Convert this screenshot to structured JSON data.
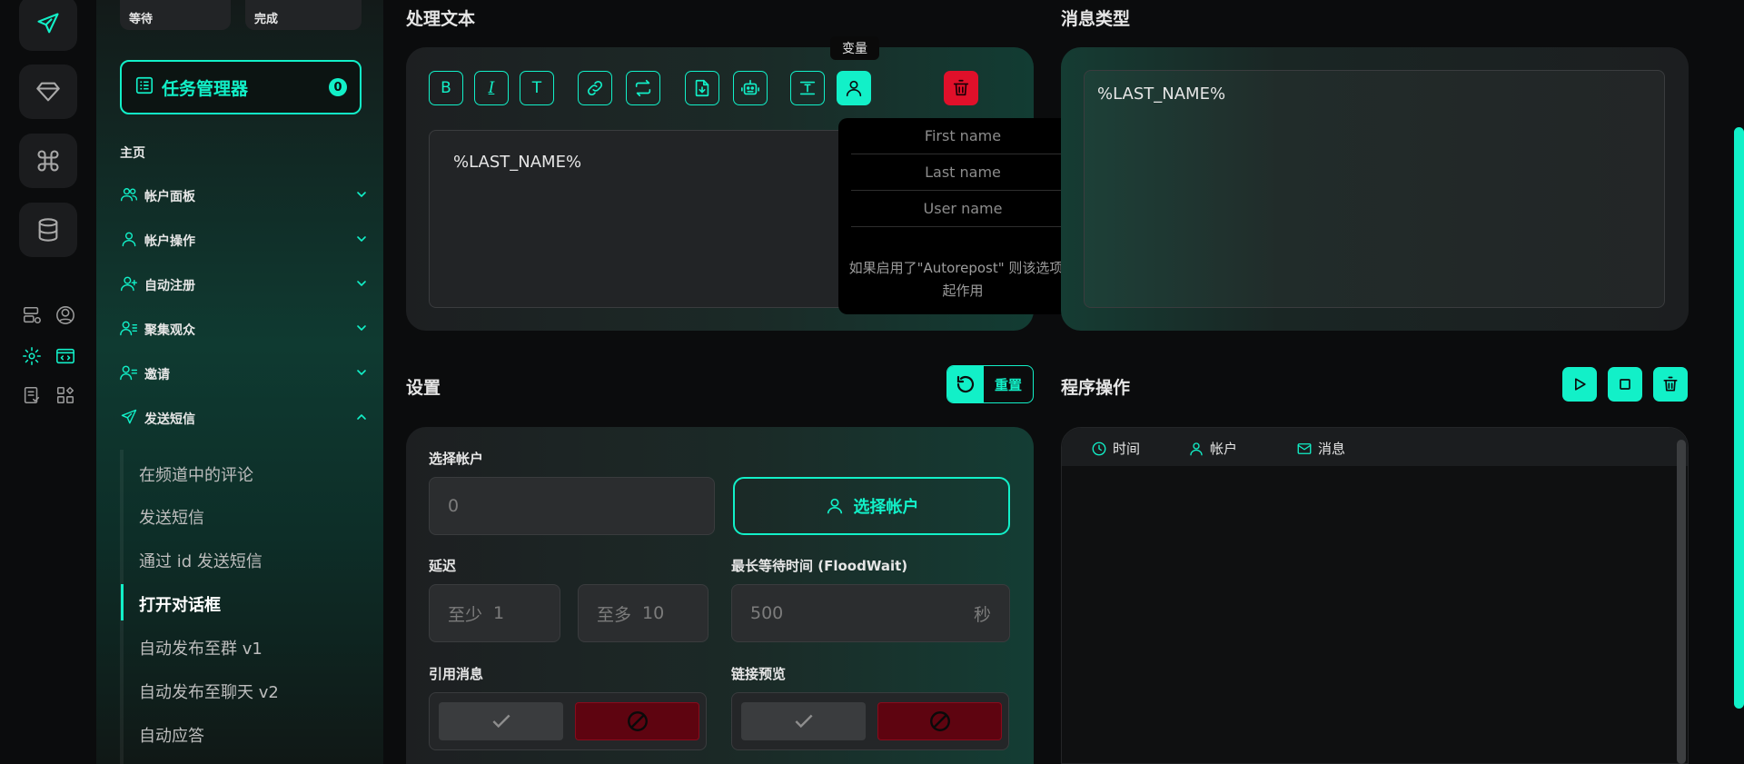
{
  "sidebar": {
    "status_waiting": "等待",
    "status_done": "完成",
    "task_manager": {
      "label": "任务管理器",
      "count": "0"
    },
    "home": "主页",
    "nav": [
      {
        "label": "帐户面板",
        "icon": "users-icon"
      },
      {
        "label": "帐户操作",
        "icon": "user-icon"
      },
      {
        "label": "自动注册",
        "icon": "user-plus-icon"
      },
      {
        "label": "聚集观众",
        "icon": "users-list-icon"
      },
      {
        "label": "邀请",
        "icon": "user-list-icon"
      },
      {
        "label": "发送短信",
        "icon": "send-icon"
      }
    ],
    "sub_items": [
      "在频道中的评论",
      "发送短信",
      "通过 id 发送短信",
      "打开对话框",
      "自动发布至群 v1",
      "自动发布至聊天 v2",
      "自动应答"
    ],
    "active_sub": "打开对话框"
  },
  "editor": {
    "title": "处理文本",
    "tooltip": "变量",
    "text": "%LAST_NAME%",
    "toolbar": {
      "bold": "B",
      "italic": "I",
      "text": "T"
    },
    "variables": [
      "First name",
      "Last name",
      "User name"
    ],
    "variables_note": "如果启用了\"Autorepost\" 则该选项不起作用"
  },
  "message_type": {
    "title": "消息类型",
    "text": "%LAST_NAME%"
  },
  "settings": {
    "title": "设置",
    "reset": "重置",
    "select_account_label": "选择帐户",
    "account_count": "0",
    "select_account_button": "选择帐户",
    "delay_label": "延迟",
    "delay_min_prefix": "至少",
    "delay_min": "1",
    "delay_max_prefix": "至多",
    "delay_max": "10",
    "floodwait_label": "最长等待时间 (FloodWait)",
    "floodwait_value": "500",
    "floodwait_unit": "秒",
    "quote_label": "引用消息",
    "preview_label": "链接预览"
  },
  "program": {
    "title": "程序操作",
    "columns": [
      "时间",
      "帐户",
      "消息"
    ]
  },
  "colors": {
    "accent": "#12f0c8",
    "danger": "#e0102a",
    "background": "#0b0c0d"
  }
}
